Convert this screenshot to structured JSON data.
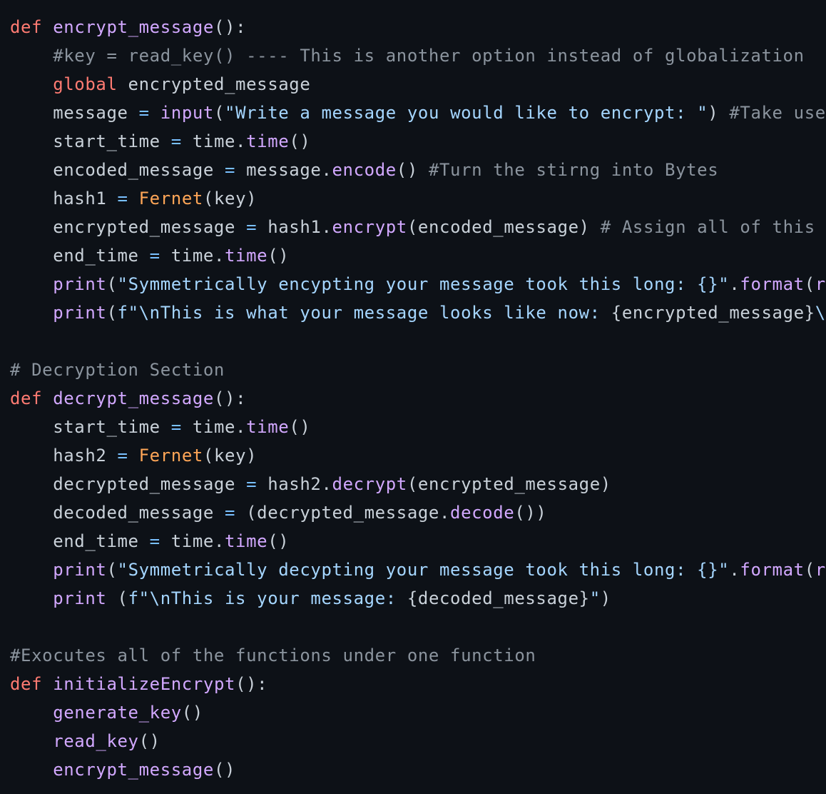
{
  "colors": {
    "background": "#0d1117",
    "keyword": "#ff7b72",
    "function": "#d2a8ff",
    "string": "#a5d6ff",
    "comment": "#8b949e",
    "class": "#ffa657",
    "operator": "#79c0ff",
    "text": "#c9d1d9"
  },
  "code": {
    "lines": [
      [
        {
          "t": "def",
          "c": "kw"
        },
        {
          "t": " ",
          "c": "pl"
        },
        {
          "t": "encrypt_message",
          "c": "fn"
        },
        {
          "t": "():",
          "c": "pl"
        }
      ],
      [
        {
          "t": "    ",
          "c": "pl"
        },
        {
          "t": "#key = read_key() ---- This is another option instead of globalization",
          "c": "cm"
        }
      ],
      [
        {
          "t": "    ",
          "c": "pl"
        },
        {
          "t": "global",
          "c": "kw"
        },
        {
          "t": " encrypted_message",
          "c": "pl"
        }
      ],
      [
        {
          "t": "    message ",
          "c": "pl"
        },
        {
          "t": "=",
          "c": "op"
        },
        {
          "t": " ",
          "c": "pl"
        },
        {
          "t": "input",
          "c": "fn"
        },
        {
          "t": "(",
          "c": "pl"
        },
        {
          "t": "\"Write a message you would like to encrypt: \"",
          "c": "str"
        },
        {
          "t": ") ",
          "c": "pl"
        },
        {
          "t": "#Take user in",
          "c": "cm"
        }
      ],
      [
        {
          "t": "    start_time ",
          "c": "pl"
        },
        {
          "t": "=",
          "c": "op"
        },
        {
          "t": " time.",
          "c": "pl"
        },
        {
          "t": "time",
          "c": "fn"
        },
        {
          "t": "()",
          "c": "pl"
        }
      ],
      [
        {
          "t": "    encoded_message ",
          "c": "pl"
        },
        {
          "t": "=",
          "c": "op"
        },
        {
          "t": " message.",
          "c": "pl"
        },
        {
          "t": "encode",
          "c": "fn"
        },
        {
          "t": "() ",
          "c": "pl"
        },
        {
          "t": "#Turn the stirng into Bytes",
          "c": "cm"
        }
      ],
      [
        {
          "t": "    hash1 ",
          "c": "pl"
        },
        {
          "t": "=",
          "c": "op"
        },
        {
          "t": " ",
          "c": "pl"
        },
        {
          "t": "Fernet",
          "c": "cls"
        },
        {
          "t": "(key)",
          "c": "pl"
        }
      ],
      [
        {
          "t": "    encrypted_message ",
          "c": "pl"
        },
        {
          "t": "=",
          "c": "op"
        },
        {
          "t": " hash1.",
          "c": "pl"
        },
        {
          "t": "encrypt",
          "c": "fn"
        },
        {
          "t": "(encoded_message) ",
          "c": "pl"
        },
        {
          "t": "# Assign all of this to a",
          "c": "cm"
        }
      ],
      [
        {
          "t": "    end_time ",
          "c": "pl"
        },
        {
          "t": "=",
          "c": "op"
        },
        {
          "t": " time.",
          "c": "pl"
        },
        {
          "t": "time",
          "c": "fn"
        },
        {
          "t": "()",
          "c": "pl"
        }
      ],
      [
        {
          "t": "    ",
          "c": "pl"
        },
        {
          "t": "print",
          "c": "fn"
        },
        {
          "t": "(",
          "c": "pl"
        },
        {
          "t": "\"Symmetrically encypting your message took this long: {}\"",
          "c": "str"
        },
        {
          "t": ".",
          "c": "pl"
        },
        {
          "t": "format",
          "c": "fn"
        },
        {
          "t": "(",
          "c": "pl"
        },
        {
          "t": "round",
          "c": "fn"
        }
      ],
      [
        {
          "t": "    ",
          "c": "pl"
        },
        {
          "t": "print",
          "c": "fn"
        },
        {
          "t": "(",
          "c": "pl"
        },
        {
          "t": "f\"\\nThis is what your message looks like now: ",
          "c": "str"
        },
        {
          "t": "{encrypted_message}",
          "c": "pl"
        },
        {
          "t": "\\n Th",
          "c": "str"
        }
      ],
      [],
      [
        {
          "t": "# Decryption Section",
          "c": "cm"
        }
      ],
      [
        {
          "t": "def",
          "c": "kw"
        },
        {
          "t": " ",
          "c": "pl"
        },
        {
          "t": "decrypt_message",
          "c": "fn"
        },
        {
          "t": "():",
          "c": "pl"
        }
      ],
      [
        {
          "t": "    start_time ",
          "c": "pl"
        },
        {
          "t": "=",
          "c": "op"
        },
        {
          "t": " time.",
          "c": "pl"
        },
        {
          "t": "time",
          "c": "fn"
        },
        {
          "t": "()",
          "c": "pl"
        }
      ],
      [
        {
          "t": "    hash2 ",
          "c": "pl"
        },
        {
          "t": "=",
          "c": "op"
        },
        {
          "t": " ",
          "c": "pl"
        },
        {
          "t": "Fernet",
          "c": "cls"
        },
        {
          "t": "(key)",
          "c": "pl"
        }
      ],
      [
        {
          "t": "    decrypted_message ",
          "c": "pl"
        },
        {
          "t": "=",
          "c": "op"
        },
        {
          "t": " hash2.",
          "c": "pl"
        },
        {
          "t": "decrypt",
          "c": "fn"
        },
        {
          "t": "(encrypted_message)",
          "c": "pl"
        }
      ],
      [
        {
          "t": "    decoded_message ",
          "c": "pl"
        },
        {
          "t": "=",
          "c": "op"
        },
        {
          "t": " (decrypted_message.",
          "c": "pl"
        },
        {
          "t": "decode",
          "c": "fn"
        },
        {
          "t": "())",
          "c": "pl"
        }
      ],
      [
        {
          "t": "    end_time ",
          "c": "pl"
        },
        {
          "t": "=",
          "c": "op"
        },
        {
          "t": " time.",
          "c": "pl"
        },
        {
          "t": "time",
          "c": "fn"
        },
        {
          "t": "()",
          "c": "pl"
        }
      ],
      [
        {
          "t": "    ",
          "c": "pl"
        },
        {
          "t": "print",
          "c": "fn"
        },
        {
          "t": "(",
          "c": "pl"
        },
        {
          "t": "\"Symmetrically decypting your message took this long: {}\"",
          "c": "str"
        },
        {
          "t": ".",
          "c": "pl"
        },
        {
          "t": "format",
          "c": "fn"
        },
        {
          "t": "(",
          "c": "pl"
        },
        {
          "t": "round",
          "c": "fn"
        }
      ],
      [
        {
          "t": "    ",
          "c": "pl"
        },
        {
          "t": "print",
          "c": "fn"
        },
        {
          "t": " (",
          "c": "pl"
        },
        {
          "t": "f\"\\nThis is your message: ",
          "c": "str"
        },
        {
          "t": "{decoded_message}",
          "c": "pl"
        },
        {
          "t": "\"",
          "c": "str"
        },
        {
          "t": ")",
          "c": "pl"
        }
      ],
      [],
      [
        {
          "t": "#Exocutes all of the functions under one function",
          "c": "cm"
        }
      ],
      [
        {
          "t": "def",
          "c": "kw"
        },
        {
          "t": " ",
          "c": "pl"
        },
        {
          "t": "initializeEncrypt",
          "c": "fn"
        },
        {
          "t": "():",
          "c": "pl"
        }
      ],
      [
        {
          "t": "    ",
          "c": "pl"
        },
        {
          "t": "generate_key",
          "c": "fn"
        },
        {
          "t": "()",
          "c": "pl"
        }
      ],
      [
        {
          "t": "    ",
          "c": "pl"
        },
        {
          "t": "read_key",
          "c": "fn"
        },
        {
          "t": "()",
          "c": "pl"
        }
      ],
      [
        {
          "t": "    ",
          "c": "pl"
        },
        {
          "t": "encrypt_message",
          "c": "fn"
        },
        {
          "t": "()",
          "c": "pl"
        }
      ]
    ]
  }
}
